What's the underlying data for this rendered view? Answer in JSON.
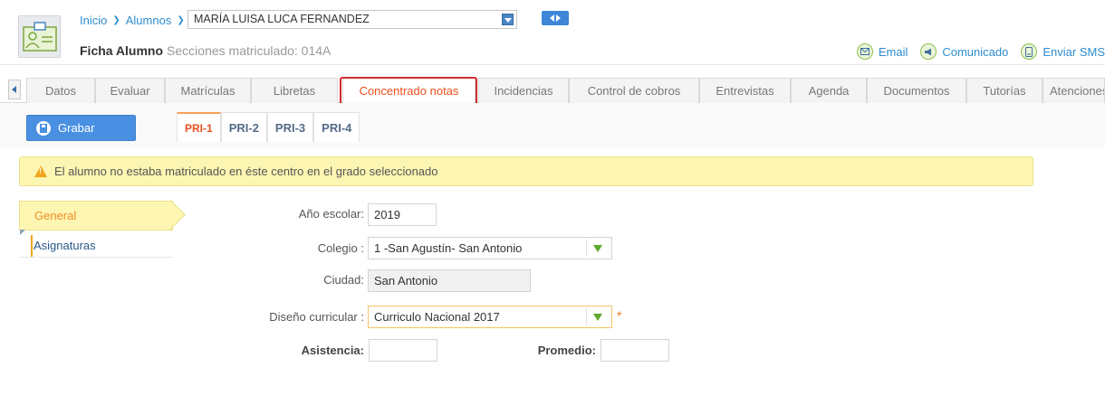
{
  "header": {
    "breadcrumb": [
      "Inicio",
      "Alumnos"
    ],
    "student_name": "MARÍA LUISA LUCA FERNANDEZ",
    "title": "Ficha Alumno",
    "subtitle": "Secciones matriculado: 014A",
    "actions": [
      {
        "label": "Email",
        "icon": "envelope-icon"
      },
      {
        "label": "Comunicado",
        "icon": "megaphone-icon"
      },
      {
        "label": "Enviar SMS",
        "icon": "phone-icon"
      }
    ]
  },
  "tabs": [
    "Datos",
    "Evaluar",
    "Matrículas",
    "Libretas",
    "Concentrado notas",
    "Incidencias",
    "Control de cobros",
    "Entrevistas",
    "Agenda",
    "Documentos",
    "Tutorías",
    "Atenciones"
  ],
  "active_tab": "Concentrado notas",
  "toolbar": {
    "save_label": "Grabar",
    "periods": [
      "PRI-1",
      "PRI-2",
      "PRI-3",
      "PRI-4"
    ],
    "active_period": "PRI-1"
  },
  "alert": {
    "text": "El alumno no estaba matriculado en éste centro en el grado seleccionado"
  },
  "sidenav": {
    "general": "General",
    "asignaturas": "Asignaturas"
  },
  "form": {
    "anio_label": "Año escolar:",
    "anio_value": "2019",
    "colegio_label": "Colegio :",
    "colegio_value": "1 -San Agustín- San Antonio",
    "ciudad_label": "Ciudad:",
    "ciudad_value": "San Antonio",
    "diseno_label": "Diseño curricular :",
    "diseno_value": "Curriculo Nacional 2017",
    "asistencia_label": "Asistencia:",
    "asistencia_value": "",
    "promedio_label": "Promedio:",
    "promedio_value": ""
  },
  "colors": {
    "accent": "#4a90e2",
    "active_tab": "#e8501c",
    "highlight": "#d22c2c",
    "alert_bg": "#fdf6b2"
  }
}
